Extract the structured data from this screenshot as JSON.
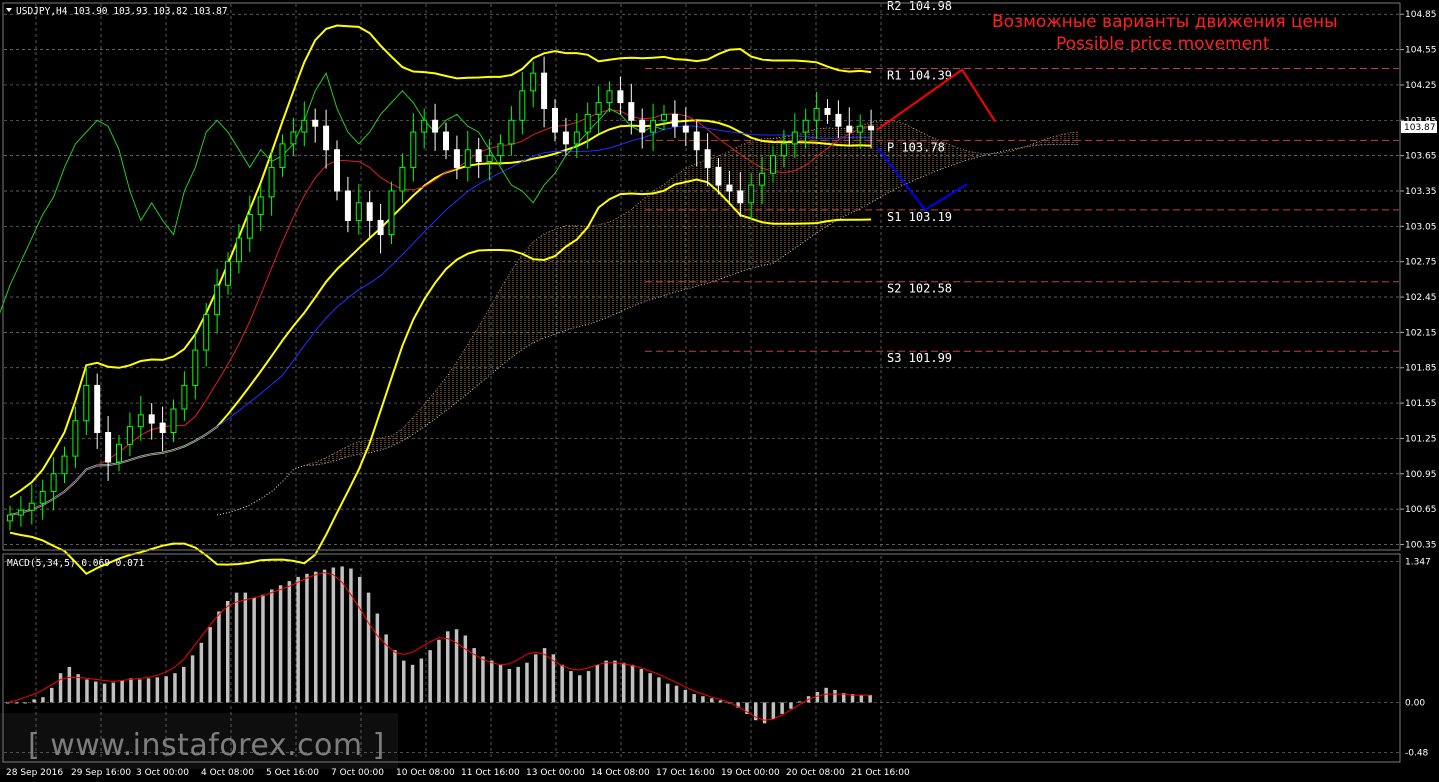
{
  "chart_data": {
    "type": "candlestick",
    "symbol_header": "USDJPY,H4  103.90 103.93 103.82 103.87",
    "current_price": "103.87",
    "price_axis_ticks": [
      "104.85",
      "104.55",
      "104.25",
      "103.95",
      "103.65",
      "103.35",
      "103.05",
      "102.75",
      "102.45",
      "102.15",
      "101.85",
      "101.55",
      "101.25",
      "100.95",
      "100.65",
      "100.35"
    ],
    "price_ylim": [
      100.32,
      104.92
    ],
    "time_labels": [
      "28 Sep 2016",
      "29 Sep 16:00",
      "3 Oct 00:00",
      "4 Oct 08:00",
      "5 Oct 16:00",
      "7 Oct 00:00",
      "10 Oct 08:00",
      "11 Oct 16:00",
      "13 Oct 00:00",
      "14 Oct 08:00",
      "17 Oct 16:00",
      "19 Oct 00:00",
      "20 Oct 08:00",
      "21 Oct 16:00"
    ],
    "pivot_levels": [
      {
        "label": "R2 104.98",
        "value": 104.98
      },
      {
        "label": "R1 104.39",
        "value": 104.39
      },
      {
        "label": "P 103.78",
        "value": 103.78
      },
      {
        "label": "S1 103.19",
        "value": 103.19
      },
      {
        "label": "S2 102.58",
        "value": 102.58
      },
      {
        "label": "S3 101.99",
        "value": 101.99
      }
    ],
    "annotation_ru": "Возможные варианты движения цены",
    "annotation_en": "Possible price movement",
    "scenario_up": [
      103.87,
      104.38,
      103.94
    ],
    "scenario_down": [
      103.72,
      103.19,
      103.41
    ],
    "close_path": [
      100.6,
      100.64,
      100.7,
      100.8,
      100.95,
      101.1,
      101.4,
      101.7,
      101.3,
      101.05,
      101.2,
      101.35,
      101.45,
      101.38,
      101.3,
      101.5,
      101.7,
      102.0,
      102.3,
      102.55,
      102.75,
      102.95,
      103.15,
      103.3,
      103.55,
      103.75,
      103.85,
      103.95,
      103.9,
      103.7,
      103.35,
      103.1,
      103.25,
      103.1,
      102.98,
      103.35,
      103.55,
      103.85,
      103.95,
      103.85,
      103.7,
      103.55,
      103.7,
      103.6,
      103.65,
      103.75,
      103.95,
      104.2,
      104.35,
      104.05,
      103.85,
      103.75,
      103.85,
      104.0,
      104.1,
      104.2,
      104.1,
      103.95,
      103.85,
      103.95,
      104.0,
      103.9,
      103.85,
      103.7,
      103.55,
      103.4,
      103.35,
      103.25,
      103.4,
      103.5,
      103.65,
      103.75,
      103.85,
      103.95,
      104.05,
      104.0,
      103.9,
      103.85,
      103.9,
      103.87
    ],
    "macd_label": "MACD(5,34,5) 0.069 0.071",
    "macd_ticks": [
      "1.347",
      "0.00",
      "-0.48"
    ],
    "macd_ylim": [
      -0.55,
      1.4
    ],
    "macd_hist": [
      0.0,
      0.0,
      0.0,
      0.03,
      0.05,
      0.14,
      0.28,
      0.34,
      0.27,
      0.22,
      0.2,
      0.18,
      0.19,
      0.21,
      0.23,
      0.22,
      0.23,
      0.24,
      0.25,
      0.28,
      0.34,
      0.45,
      0.57,
      0.72,
      0.87,
      0.97,
      1.05,
      1.05,
      1.0,
      1.03,
      1.08,
      1.12,
      1.16,
      1.2,
      1.23,
      1.25,
      1.27,
      1.29,
      1.3,
      1.28,
      1.2,
      1.05,
      0.85,
      0.65,
      0.5,
      0.4,
      0.36,
      0.42,
      0.5,
      0.6,
      0.68,
      0.7,
      0.64,
      0.52,
      0.44,
      0.4,
      0.36,
      0.32,
      0.34,
      0.38,
      0.46,
      0.52,
      0.46,
      0.36,
      0.3,
      0.26,
      0.3,
      0.36,
      0.4,
      0.4,
      0.38,
      0.36,
      0.32,
      0.28,
      0.24,
      0.18,
      0.16,
      0.12,
      0.08,
      0.06,
      0.04,
      0.02,
      0.0,
      -0.05,
      -0.11,
      -0.17,
      -0.2,
      -0.16,
      -0.11,
      -0.06,
      0.01,
      0.06,
      0.1,
      0.14,
      0.12,
      0.09,
      0.08,
      0.07,
      0.07
    ],
    "macd_signal": [
      0.0,
      0.02,
      0.05,
      0.08,
      0.12,
      0.17,
      0.22,
      0.24,
      0.24,
      0.23,
      0.22,
      0.21,
      0.2,
      0.21,
      0.22,
      0.23,
      0.24,
      0.26,
      0.29,
      0.34,
      0.41,
      0.52,
      0.63,
      0.74,
      0.84,
      0.92,
      0.96,
      0.98,
      1.0,
      1.02,
      1.05,
      1.08,
      1.11,
      1.15,
      1.19,
      1.22,
      1.24,
      1.22,
      1.15,
      1.03,
      0.9,
      0.76,
      0.64,
      0.55,
      0.48,
      0.46,
      0.48,
      0.53,
      0.58,
      0.62,
      0.61,
      0.57,
      0.51,
      0.46,
      0.41,
      0.38,
      0.36,
      0.37,
      0.41,
      0.46,
      0.48,
      0.46,
      0.4,
      0.35,
      0.32,
      0.31,
      0.33,
      0.36,
      0.38,
      0.38,
      0.37,
      0.35,
      0.33,
      0.3,
      0.27,
      0.23,
      0.19,
      0.15,
      0.11,
      0.08,
      0.05,
      0.03,
      0.0,
      -0.04,
      -0.09,
      -0.14,
      -0.17,
      -0.16,
      -0.12,
      -0.07,
      -0.02,
      0.03,
      0.06,
      0.08,
      0.08,
      0.08,
      0.07,
      0.07,
      0.07
    ],
    "grid": true,
    "colors": {
      "background": "#000000",
      "bull_candle": "#00ff00",
      "bear_candle": "#ffffff",
      "bollinger": "#ffff00",
      "grid": "#7a7a7a",
      "macd_hist": "#c0c0c0",
      "macd_signal": "#ff0000",
      "pivot_line": "#c04040",
      "scenario_up": "#ff0000",
      "scenario_down": "#0000ff",
      "annotation": "#ff2020"
    }
  },
  "watermark": "[ www.instaforex.com ]"
}
